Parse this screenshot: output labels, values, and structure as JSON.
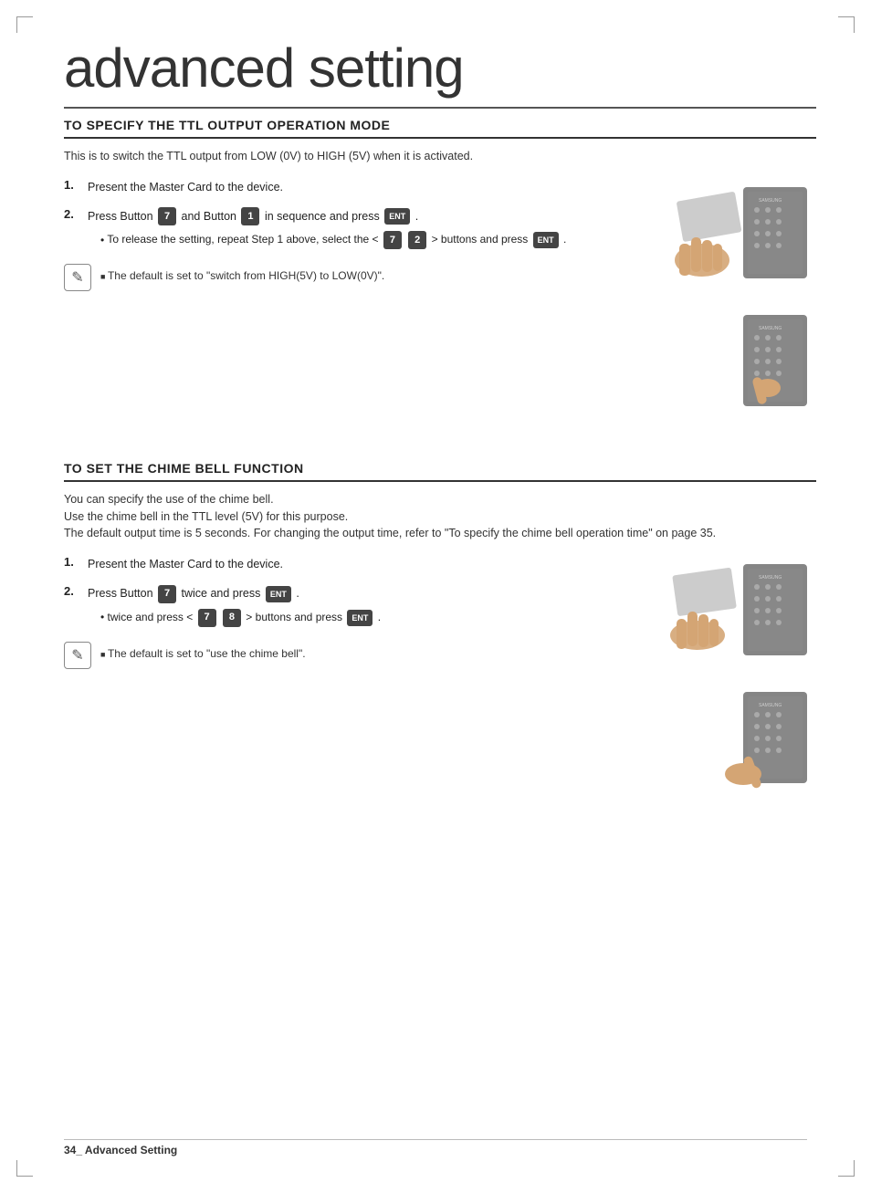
{
  "page": {
    "title": "advanced setting",
    "footer": "34_ Advanced Setting"
  },
  "section1": {
    "title": "TO SPECIFY THE TTL OUTPUT OPERATION MODE",
    "description": "This is to switch the TTL output from LOW (0V) to HIGH (5V) when it is activated.",
    "step1": {
      "num": "1.",
      "text": "Present the Master Card to the device."
    },
    "step2": {
      "num": "2.",
      "text": "Press Button",
      "key1": "7",
      "mid": "and Button",
      "key2": "1",
      "end": "in sequence and press",
      "ent": "ENT"
    },
    "sub": {
      "prefix": "To release the setting, repeat Step 1 above, select the <",
      "key1": "7",
      "key2": "2",
      "suffix": "> buttons and press",
      "ent": "ENT"
    },
    "note": "The default is set to \"switch from HIGH(5V) to LOW(0V)\"."
  },
  "section2": {
    "title": "TO SET THE CHIME BELL FUNCTION",
    "desc1": "You can specify the use of the chime bell.",
    "desc2": "Use the chime bell in the TTL level (5V) for this purpose.",
    "desc3": "The default output time is 5 seconds. For changing the output time, refer to \"To specify the chime bell operation time\" on page 35.",
    "step1": {
      "num": "1.",
      "text": "Present the Master Card to the device."
    },
    "step2": {
      "num": "2.",
      "prefix": "Press Button",
      "key1": "7",
      "mid": "twice and press",
      "ent": "ENT"
    },
    "sub": {
      "prefix": "twice and press <",
      "key1": "7",
      "key2": "8",
      "suffix": "> buttons and press",
      "ent": "ENT"
    },
    "note": "The default is set to \"use the chime bell\"."
  }
}
